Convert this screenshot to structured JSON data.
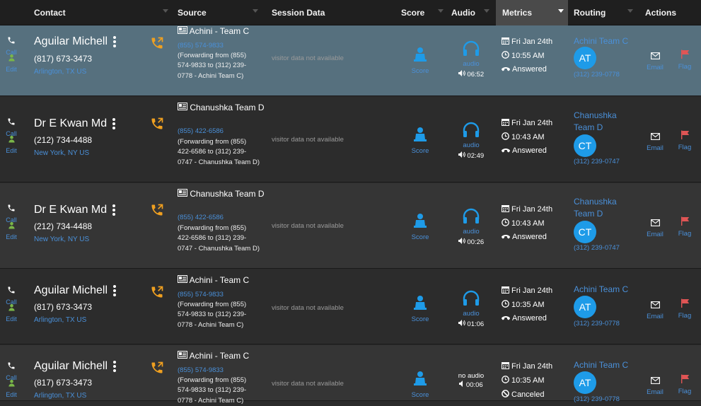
{
  "header": {
    "contact": "Contact",
    "source": "Source",
    "session": "Session Data",
    "score": "Score",
    "audio": "Audio",
    "metrics": "Metrics",
    "routing": "Routing",
    "actions": "Actions"
  },
  "labels": {
    "call": "Call",
    "edit": "Edit",
    "score": "Score",
    "audio": "audio",
    "no_audio": "no audio",
    "email": "Email",
    "flag": "Flag"
  },
  "colors": {
    "link": "#4a90d9",
    "selected_row": "#56707e",
    "avatar": "#1e9be8",
    "call_icon": "#f0a020",
    "flag": "#e05555",
    "edit_icon": "#7ab648"
  },
  "rows": [
    {
      "name": "Aguilar Michell",
      "phone": "(817) 673-3473",
      "city": "Arlington",
      "region": "TX US",
      "source_title": "Achini - Team C",
      "source_number": "(855) 574-9833",
      "forwarding": "(Forwarding from (855) 574-9833 to (312) 239-0778 - Achini Team C)",
      "session": "visitor data not available",
      "audio_available": true,
      "duration": "06:52",
      "date": "Fri Jan 24th",
      "time": "10:55 AM",
      "status": "Answered",
      "route_name": "Achini Team C",
      "initials": "AT",
      "route_phone": "(312) 239-0778",
      "flagged": true,
      "selected": true
    },
    {
      "name": "Dr E Kwan Md",
      "phone": "(212) 734-4488",
      "city": "New York",
      "region": "NY US",
      "source_title": "Chanushka Team D",
      "source_number": "(855) 422-6586",
      "forwarding": "(Forwarding from (855) 422-6586 to (312) 239-0747 - Chanushka Team D)",
      "session": "visitor data not available",
      "audio_available": true,
      "duration": "02:49",
      "date": "Fri Jan 24th",
      "time": "10:43 AM",
      "status": "Answered",
      "route_name": "Chanushka Team D",
      "initials": "CT",
      "route_phone": "(312) 239-0747",
      "flagged": true,
      "selected": false
    },
    {
      "name": "Dr E Kwan Md",
      "phone": "(212) 734-4488",
      "city": "New York",
      "region": "NY US",
      "source_title": "Chanushka Team D",
      "source_number": "(855) 422-6586",
      "forwarding": "(Forwarding from (855) 422-6586 to (312) 239-0747 - Chanushka Team D)",
      "session": "visitor data not available",
      "audio_available": true,
      "duration": "00:26",
      "date": "Fri Jan 24th",
      "time": "10:43 AM",
      "status": "Answered",
      "route_name": "Chanushka Team D",
      "initials": "CT",
      "route_phone": "(312) 239-0747",
      "flagged": true,
      "selected": false
    },
    {
      "name": "Aguilar Michell",
      "phone": "(817) 673-3473",
      "city": "Arlington",
      "region": "TX US",
      "source_title": "Achini - Team C",
      "source_number": "(855) 574-9833",
      "forwarding": "(Forwarding from (855) 574-9833 to (312) 239-0778 - Achini Team C)",
      "session": "visitor data not available",
      "audio_available": true,
      "duration": "01:06",
      "date": "Fri Jan 24th",
      "time": "10:35 AM",
      "status": "Answered",
      "route_name": "Achini Team C",
      "initials": "AT",
      "route_phone": "(312) 239-0778",
      "flagged": true,
      "selected": false
    },
    {
      "name": "Aguilar Michell",
      "phone": "(817) 673-3473",
      "city": "Arlington",
      "region": "TX US",
      "source_title": "Achini - Team C",
      "source_number": "(855) 574-9833",
      "forwarding": "(Forwarding from (855) 574-9833 to (312) 239-0778 - Achini Team C)",
      "session": "visitor data not available",
      "audio_available": false,
      "duration": "00:06",
      "date": "Fri Jan 24th",
      "time": "10:35 AM",
      "status": "Canceled",
      "route_name": "Achini Team C",
      "initials": "AT",
      "route_phone": "(312) 239-0778",
      "flagged": true,
      "selected": false
    }
  ]
}
